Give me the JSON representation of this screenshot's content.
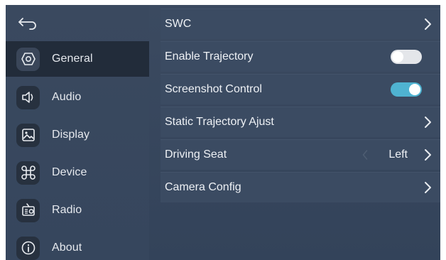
{
  "sidebar": {
    "back_icon": "back-arrow-icon",
    "items": [
      {
        "label": "General",
        "icon": "general-icon",
        "active": true
      },
      {
        "label": "Audio",
        "icon": "speaker-icon",
        "active": false
      },
      {
        "label": "Display",
        "icon": "image-icon",
        "active": false
      },
      {
        "label": "Device",
        "icon": "command-icon",
        "active": false
      },
      {
        "label": "Radio",
        "icon": "radio-icon",
        "active": false
      },
      {
        "label": "About",
        "icon": "info-icon",
        "active": false
      }
    ]
  },
  "settings": {
    "swc": {
      "label": "SWC"
    },
    "enable_trajectory": {
      "label": "Enable Trajectory",
      "enabled": false
    },
    "screenshot_control": {
      "label": "Screenshot Control",
      "enabled": true
    },
    "static_trajectory": {
      "label": "Static Trajectory Ajust"
    },
    "driving_seat": {
      "label": "Driving Seat",
      "value": "Left"
    },
    "camera_config": {
      "label": "Camera Config"
    }
  },
  "colors": {
    "background": "#36465d",
    "sidebar_active": "#222c3a",
    "row": "#3b4b62",
    "toggle_on": "#4fb3d1",
    "toggle_off": "#e4e6ea",
    "text": "#eef1f5"
  }
}
